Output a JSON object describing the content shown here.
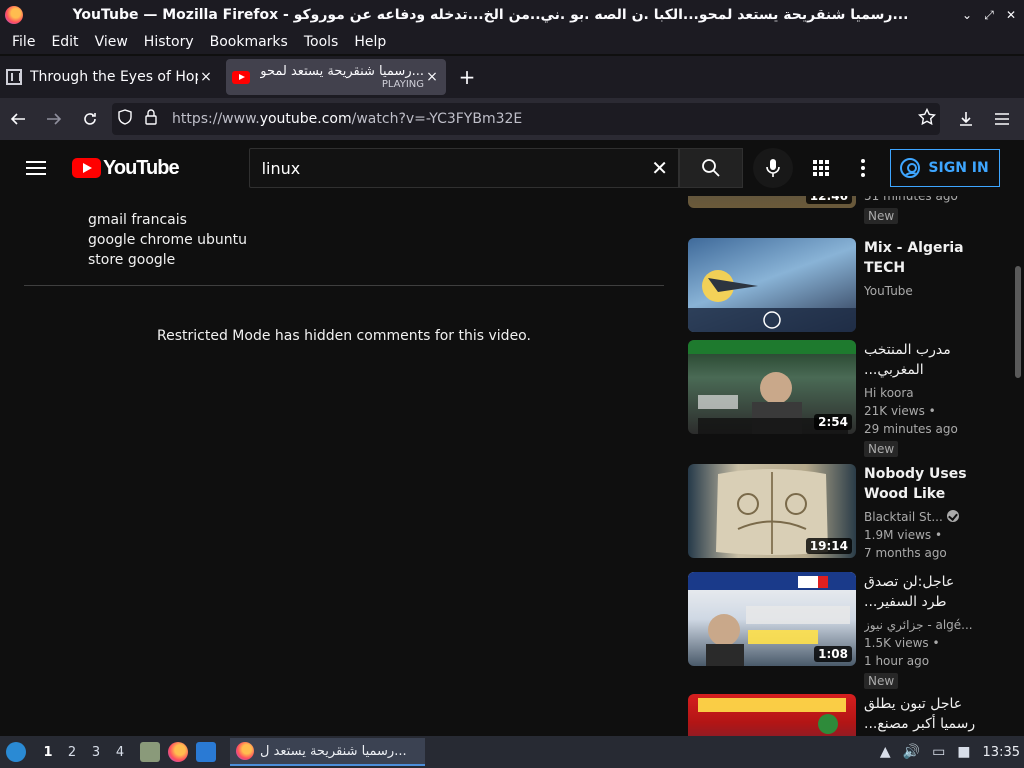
{
  "window": {
    "title": "YouTube — Mozilla Firefox - رسميا شنقريحة يستعد لمحو...الكبا .ن الصه .بو .ني..من الخ...تدخله ودفاعه عن موروكو..."
  },
  "menubar": [
    "File",
    "Edit",
    "View",
    "History",
    "Bookmarks",
    "Tools",
    "Help"
  ],
  "tabs": [
    {
      "label": "Through the Eyes of Hope",
      "close": "×"
    },
    {
      "label": "رسميا شنقريحة يستعد لمحو...",
      "sub": "PLAYING",
      "close": "×"
    }
  ],
  "newtab": "+",
  "nav": {
    "url_pre": "https://www.",
    "url_host": "youtube.com",
    "url_path": "/watch?v=-YC3FYBm32E"
  },
  "youtube": {
    "logo_text": "YouTube",
    "search_value": "linux",
    "signin_label": "SIGN IN"
  },
  "description": {
    "lines": [
      "gmail francais",
      "google chrome ubuntu",
      "store google"
    ]
  },
  "restricted_text": "Restricted Mode has hidden comments for this video.",
  "sidebar": {
    "videos": [
      {
        "title": "",
        "channel": "",
        "meta1": "51 minutes ago",
        "meta2": "",
        "duration": "12:46",
        "badge": "New"
      },
      {
        "title": "Mix - Algeria TECH",
        "channel": "YouTube",
        "meta1": "",
        "meta2": "",
        "duration": "",
        "badge": ""
      },
      {
        "title": "مدرب المنتخب المغربي...",
        "channel": "Hi koora",
        "meta1": "21K views •",
        "meta2": "29 minutes ago",
        "duration": "2:54",
        "badge": "New"
      },
      {
        "title": "Nobody Uses Wood Like Thi...",
        "channel": "Blacktail St...",
        "meta1": "1.9M views •",
        "meta2": "7 months ago",
        "duration": "19:14",
        "badge": ""
      },
      {
        "title": "عاجل:لن تصدق طرد السفير...",
        "channel": "جزائري نيوز - algé...",
        "meta1": "1.5K views •",
        "meta2": "1 hour ago",
        "duration": "1:08",
        "badge": "New"
      },
      {
        "title": "عاجل تبون يطلق رسميا أكبر مصنع...",
        "channel": "",
        "meta1": "",
        "meta2": "",
        "duration": "",
        "badge": ""
      }
    ]
  },
  "taskbar": {
    "workspaces": [
      "1",
      "2",
      "3",
      "4"
    ],
    "task_label": "رسميا شنقريحة يستعد ل...",
    "clock": "13:35"
  }
}
